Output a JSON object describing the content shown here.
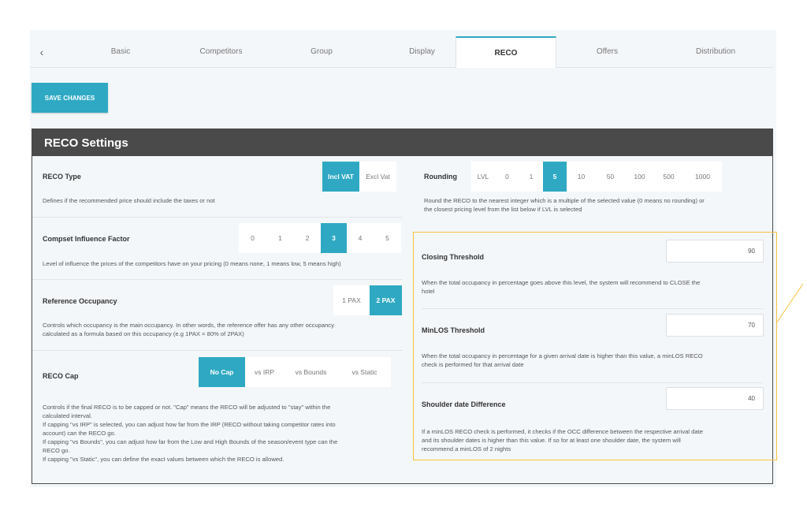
{
  "tabs": {
    "back_icon": "chevron-left-icon",
    "items": [
      {
        "label": "Basic"
      },
      {
        "label": "Competitors"
      },
      {
        "label": "Group"
      },
      {
        "label": "Display"
      },
      {
        "label": "RECO"
      },
      {
        "label": "Offers"
      },
      {
        "label": "Distribution"
      }
    ],
    "active": "RECO"
  },
  "toolbar": {
    "save_label": "SAVE CHANGES"
  },
  "panel": {
    "title": "RECO Settings"
  },
  "colors": {
    "accent": "#2fa9c3",
    "header": "#4a4a4a",
    "highlight": "#f5c242"
  },
  "left": {
    "reco_type": {
      "label": "RECO Type",
      "options": [
        "Incl VAT",
        "Excl Vat"
      ],
      "selected": "Incl VAT",
      "description": "Defines if the recommended price should include the taxes or not"
    },
    "compset": {
      "label": "Compset Influence Factor",
      "options": [
        "0",
        "1",
        "2",
        "3",
        "4",
        "5"
      ],
      "selected": "3",
      "description": "Level of influence the prices of the competitors have on your pricing (0 means none, 1 means low, 5 means high)"
    },
    "reference_occupancy": {
      "label": "Reference Occupancy",
      "options": [
        "1 PAX",
        "2 PAX"
      ],
      "selected": "2 PAX",
      "description_1": "Controls which occupancy is the main occupancy. In other words, the reference offer has any other occupancy",
      "description_2": "calculated as a formula based on this occupancy (e.g 1PAX = 80% of 2PAX)"
    },
    "reco_cap": {
      "label": "RECO Cap",
      "options": [
        "No Cap",
        "vs IRP",
        "vs Bounds",
        "vs Static"
      ],
      "selected": "No Cap",
      "description_lines": [
        "Controls if the final RECO is to be capped or not. \"Cap\" means the RECO will be adjusted to \"stay\" within the",
        "calculated interval.",
        "If capping \"vs IRP\" is selected, you can adjust how far from the IRP (RECO without taking competitor rates into",
        "account) can the RECO go.",
        "If capping \"vs Bounds\", you can adjust how far from the Low and High Bounds of the season/event type can the",
        "RECO go.",
        "If capping \"vs Static\", you can define the exact values between which the RECO is allowed."
      ]
    }
  },
  "right": {
    "rounding": {
      "label": "Rounding",
      "options": [
        "LVL",
        "0",
        "1",
        "5",
        "10",
        "50",
        "100",
        "500",
        "1000"
      ],
      "selected": "5",
      "description_1": "Round the RECO to the nearest integer which is a multiple of the selected value (0 means no rounding) or",
      "description_2": "the closest pricing level from the list below if LVL is selected"
    },
    "closing_threshold": {
      "label": "Closing Threshold",
      "value": "90",
      "description_1": "When the total occupancy in percentage goes above this level, the system will recommend to CLOSE the",
      "description_2": "hotel"
    },
    "minlos_threshold": {
      "label": "MinLOS Threshold",
      "value": "70",
      "description_1": "When the total occupancy in percentage for a given arrival date is higher than this value, a minLOS RECO",
      "description_2": "check is performed for that arrival date"
    },
    "shoulder_diff": {
      "label": "Shoulder date Difference",
      "value": "40",
      "description_1": "If a minLOS RECO check is performed, it checks if the OCC difference between the respective arrival date",
      "description_2": "and its shoulder dates is higher than this value. If so for at least one shoulder date, the system will",
      "description_3": "recommend a minLOS of 2 nights"
    }
  }
}
